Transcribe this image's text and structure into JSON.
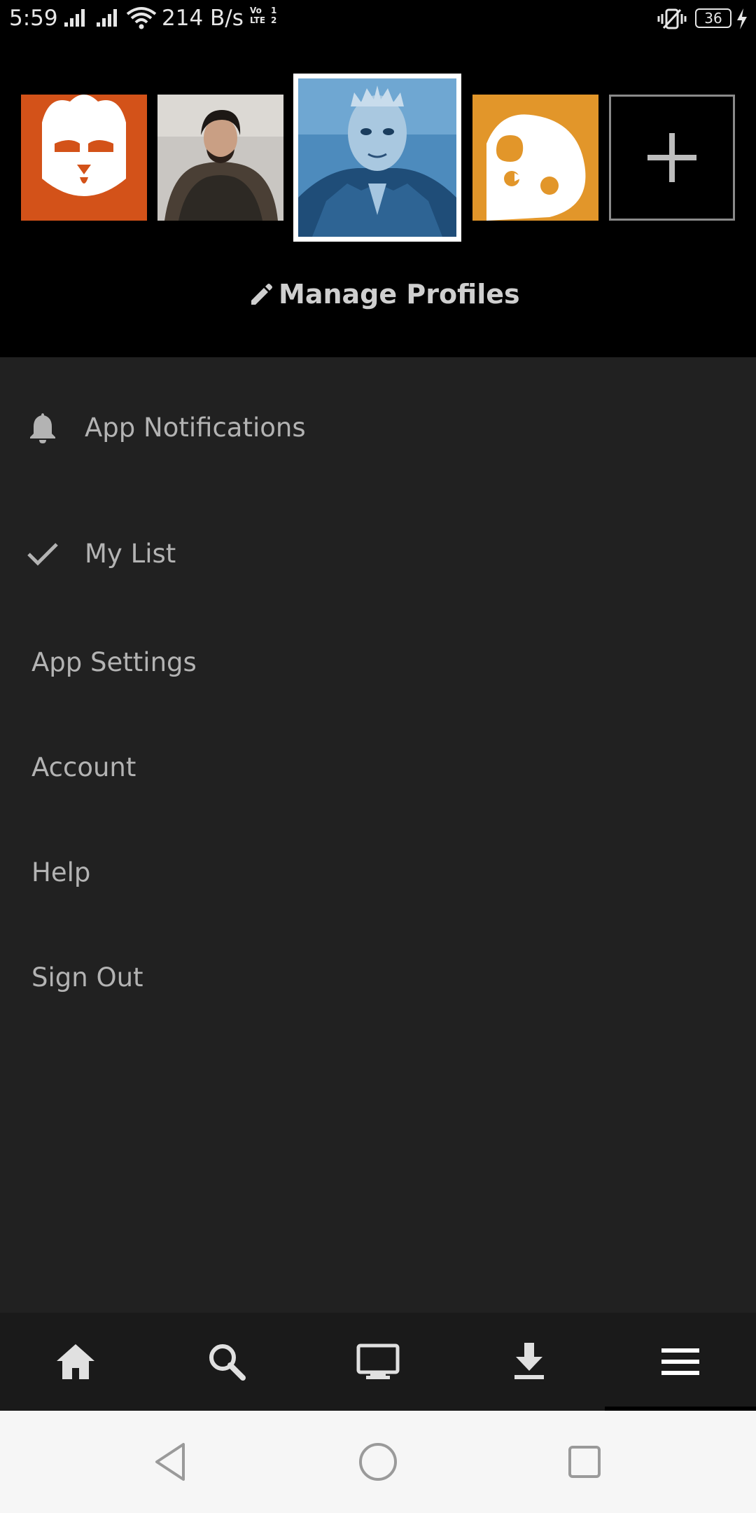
{
  "status_bar": {
    "time": "5:59",
    "network_speed": "214 B/s",
    "volte": "Vo LTE",
    "sim_slot": "1",
    "sim_slot2": "2",
    "battery": "36"
  },
  "profiles": {
    "items": [
      {
        "name": "profile-chicken",
        "color": "#d35219"
      },
      {
        "name": "profile-jon-snow",
        "color": "#7e7a75"
      },
      {
        "name": "profile-night-king",
        "color": "#2f6a94",
        "selected": true
      },
      {
        "name": "profile-kids",
        "color": "#e2962a"
      }
    ],
    "add_icon": "plus-icon",
    "manage_label": "Manage Profiles"
  },
  "menu": {
    "notifications": "App Notifications",
    "my_list": "My List",
    "app_settings": "App Settings",
    "account": "Account",
    "help": "Help",
    "sign_out": "Sign Out"
  },
  "bottom_nav": {
    "items": [
      "home-icon",
      "search-icon",
      "tv-icon",
      "download-icon",
      "menu-icon"
    ],
    "active": "menu-icon"
  },
  "system_nav": {
    "items": [
      "back-icon",
      "home-circle-icon",
      "recents-icon"
    ]
  },
  "colors": {
    "header_bg": "#000000",
    "menu_bg": "#212121",
    "bottom_nav_bg": "#1a1a1a",
    "text": "#b3b3b3",
    "system_nav_bg": "#f6f6f6"
  }
}
